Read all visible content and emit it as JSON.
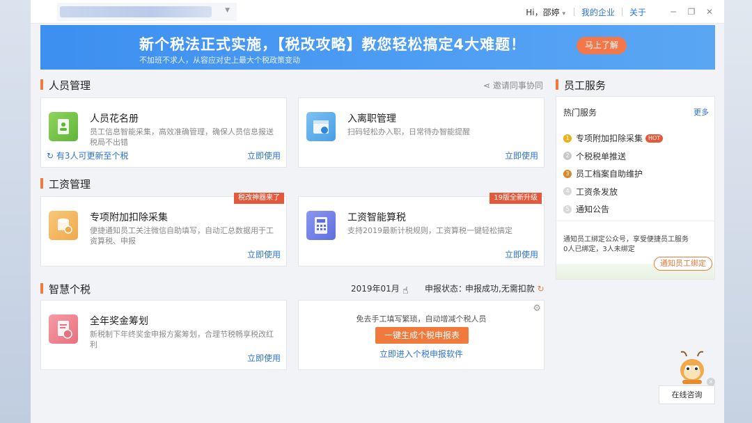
{
  "titlebar": {
    "greeting": "Hi，邵婷",
    "greeting_caret": "▾",
    "my_company": "我的企业",
    "about": "关于",
    "minimize": "─",
    "restore": "❐",
    "close": "✕"
  },
  "banner": {
    "title": "新个税法正式实施，【税改攻略】教您轻松搞定4大难题！",
    "subtitle": "不加班不求人，从容应对史上最大个税政策变动",
    "button": "马上了解"
  },
  "personnel": {
    "title": "人员管理",
    "invite": "邀请同事协同",
    "roster": {
      "title": "人员花名册",
      "desc": "员工信息智能采集，高效准确管理，确保人员信息报送税局不出错",
      "refresh": "有3人可更新至个税",
      "use": "立即使用"
    },
    "onboard": {
      "title": "入离职管理",
      "desc": "扫码轻松办入职，日常待办智能提醒",
      "use": "立即使用"
    }
  },
  "salary": {
    "title": "工资管理",
    "deduction": {
      "ribbon": "税改神器来了",
      "title": "专项附加扣除采集",
      "desc": "便捷通知员工关注微信自助填写，自动汇总数据用于工资算税、申报",
      "use": "立即使用"
    },
    "calc": {
      "ribbon": "19版全新升级",
      "title": "工资智能算税",
      "desc": "支持2019最新计税规则，工资算税一键轻松搞定",
      "use": "立即使用"
    }
  },
  "smart_tax": {
    "title": "智慧个税",
    "period": "2019年01月",
    "status_label": "申报状态：",
    "status_value": "申报成功,无需扣款",
    "bonus": {
      "title": "全年奖金筹划",
      "desc": "新税制下年终奖金申报方案筹划，合理节税畅享税改红利",
      "use": "立即使用"
    },
    "generate": {
      "hint": "免去手工填写繁琐，自动增减个税人员",
      "button": "一键生成个税申报表",
      "link": "立即进入个税申报软件"
    }
  },
  "employee_services": {
    "title": "员工服务",
    "hot_label": "热门服务",
    "more": "更多",
    "items": [
      {
        "num": "1",
        "label": "专项附加扣除采集",
        "badge": "HOT",
        "color": "#e8b21a"
      },
      {
        "num": "2",
        "label": "个税税单推送",
        "badge": "",
        "color": "#c9c9c9"
      },
      {
        "num": "3",
        "label": "员工档案自助维护",
        "badge": "",
        "color": "#d88a2a"
      },
      {
        "num": "4",
        "label": "工资条发放",
        "badge": "",
        "color": "#d8d8d8"
      },
      {
        "num": "5",
        "label": "通知公告",
        "badge": "",
        "color": "#d8d8d8"
      }
    ],
    "bind_text": "通知员工绑定公众号，享受便捷员工服务",
    "bind_stats": "0人已绑定，3人未绑定",
    "bind_button": "通知员工绑定"
  },
  "consult": {
    "label": "在线咨询",
    "close": "×"
  }
}
